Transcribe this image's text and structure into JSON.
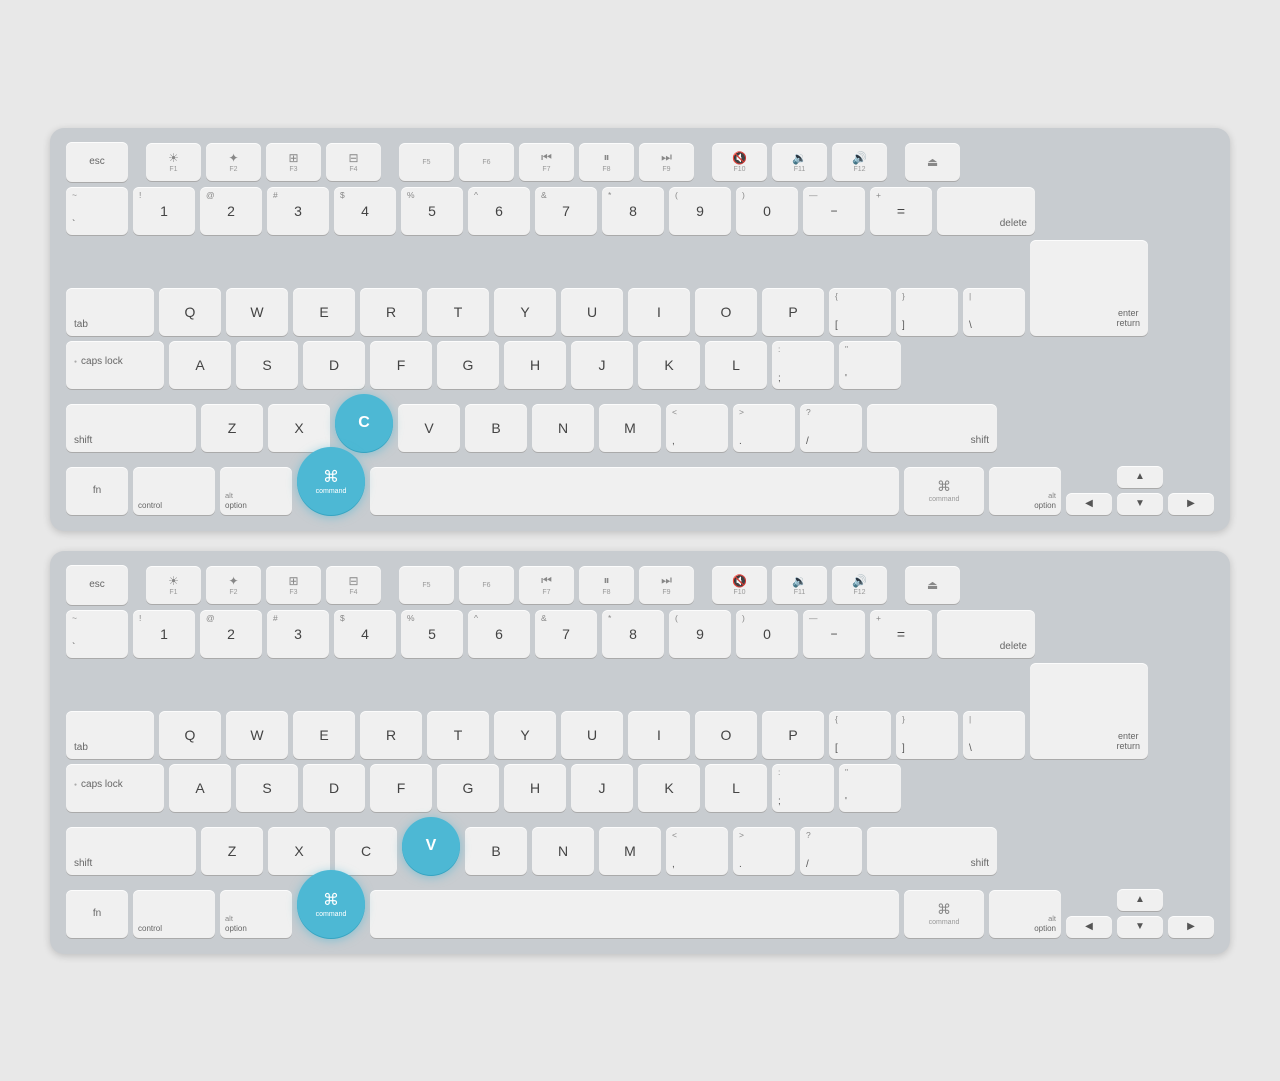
{
  "keyboards": [
    {
      "id": "keyboard-1",
      "highlighted_keys": [
        "C",
        "command-left"
      ],
      "shortcut": "Cmd+C"
    },
    {
      "id": "keyboard-2",
      "highlighted_keys": [
        "V",
        "command-left"
      ],
      "shortcut": "Cmd+V"
    }
  ],
  "keys": {
    "esc": "esc",
    "f1": "F1",
    "f2": "F2",
    "f3": "F3",
    "f4": "F4",
    "f5": "F5",
    "f6": "F6",
    "f7": "F7",
    "f8": "F8",
    "f9": "F9",
    "f10": "F10",
    "f11": "F11",
    "f12": "F12",
    "tab": "tab",
    "caps_lock": "caps lock",
    "shift": "shift",
    "fn": "fn",
    "control": "control",
    "option": "option",
    "command": "command",
    "delete": "delete",
    "return": "return",
    "enter": "enter",
    "space": "",
    "cmd_symbol": "⌘"
  }
}
